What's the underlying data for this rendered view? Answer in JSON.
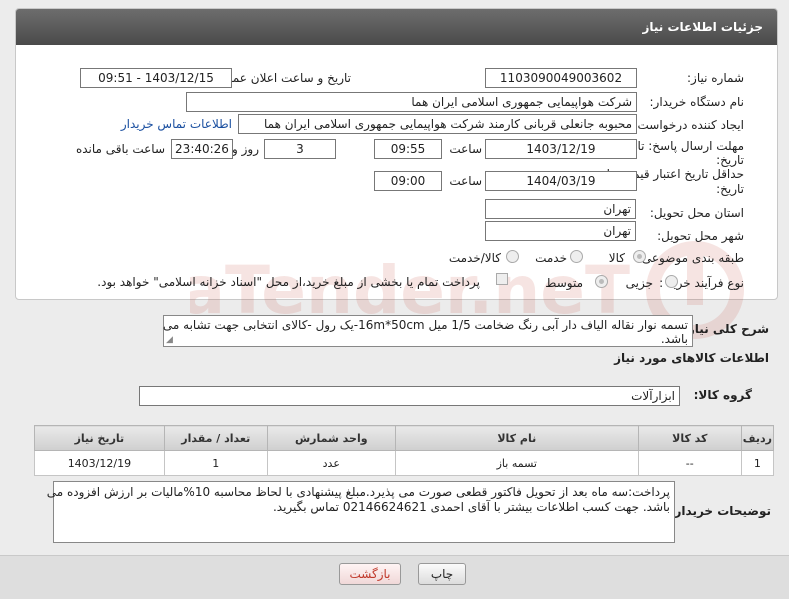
{
  "panel": {
    "title": "جزئیات اطلاعات نیاز"
  },
  "fields": {
    "need_number_label": "شماره نیاز:",
    "need_number": "1103090049003602",
    "announce_label": "تاریخ و ساعت اعلان عمومی:",
    "announce_value": "1403/12/15 - 09:51",
    "buyer_label": "نام دستگاه خریدار:",
    "buyer": "شرکت هواپیمایی جمهوری اسلامی ایران هما",
    "creator_label": "ایجاد کننده درخواست:",
    "creator": "محبوبه جانعلی قربانی کارمند شرکت هواپیمایی جمهوری اسلامی ایران هما",
    "contact_link": "اطلاعات تماس خریدار",
    "deadline_label_1": "مهلت ارسال پاسخ: تا",
    "deadline_label_2": "تاریخ:",
    "deadline_date": "1403/12/19",
    "time_label": "ساعت",
    "deadline_time": "09:55",
    "days": "3",
    "days_label": "روز و",
    "remaining_time": "23:40:26",
    "remaining_label": "ساعت باقی مانده",
    "validity_label_1": "حداقل تاریخ اعتبار قیمت: تا",
    "validity_label_2": "تاریخ:",
    "validity_date": "1404/03/19",
    "validity_time": "09:00",
    "province_label": "استان محل تحویل:",
    "province": "تهران",
    "city_label": "شهر محل تحویل:",
    "city": "تهران",
    "category_label": "طبقه بندی موضوعی:",
    "category_options": [
      "کالا",
      "خدمت",
      "کالا/خدمت"
    ],
    "process_label": "نوع فرآیند خرید :",
    "process_options": [
      "جزیی",
      "متوسط"
    ],
    "payment_note": "پرداخت تمام یا بخشی از مبلغ خرید،از محل \"اسناد خزانه اسلامی\" خواهد بود."
  },
  "description": {
    "label": "شرح کلی نیاز:",
    "line1": "تسمه نوار نقاله الیاف دار آبی رنگ ضخامت 1/5 میل 16m*50cm-یک رول -کالای انتخابی جهت تشابه می",
    "line2": "باشد."
  },
  "goods": {
    "section_title": "اطلاعات کالاهای مورد نیاز",
    "group_label": "گروه کالا:",
    "group_value": "ابزارآلات"
  },
  "table": {
    "headers": [
      "ردیف",
      "کد کالا",
      "نام کالا",
      "واحد شمارش",
      "تعداد / مقدار",
      "تاریخ نیاز"
    ],
    "rows": [
      [
        "1",
        "--",
        "تسمه باز",
        "عدد",
        "1",
        "1403/12/19"
      ]
    ]
  },
  "buyer_notes": {
    "label": "توضیحات خریدار:",
    "line1": "پرداخت:سه ماه بعد از تحویل فاکتور قطعی صورت می پذیرد.مبلغ پیشنهادی با لحاظ محاسبه 10%مالیات بر ارزش افزوده می",
    "line2": "باشد. جهت کسب اطلاعات بیشتر با آقای احمدی 02146624621 تماس بگیرید."
  },
  "buttons": {
    "print": "چاپ",
    "back": "بازگشت"
  },
  "watermark": "AriaTender.neT",
  "colors": {
    "header": "#5a5a5a",
    "link": "#1a4fa0",
    "watermark": "#c0392b"
  }
}
